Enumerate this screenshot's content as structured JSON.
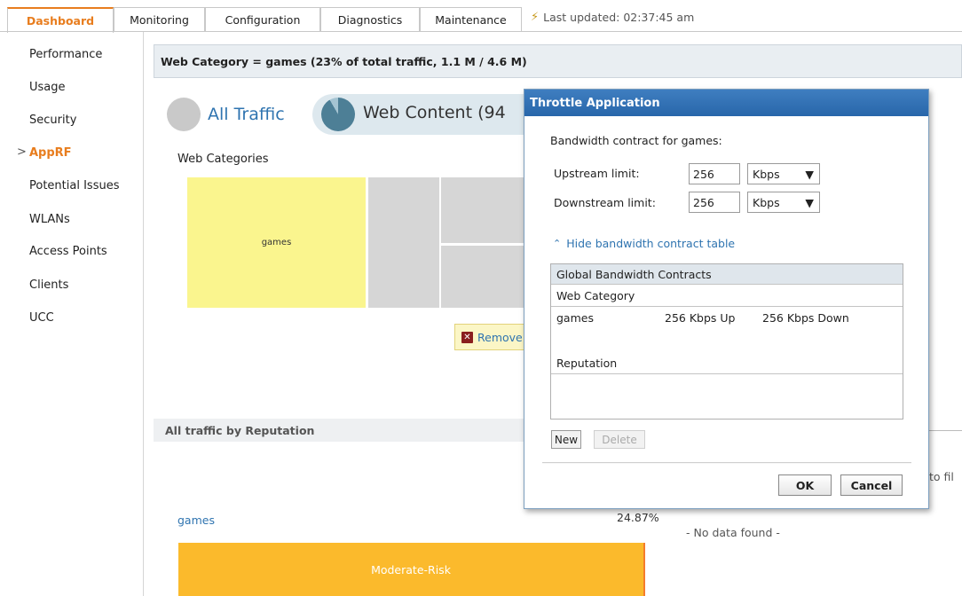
{
  "tabs": [
    {
      "label": "Dashboard",
      "active": true
    },
    {
      "label": "Monitoring"
    },
    {
      "label": "Configuration"
    },
    {
      "label": "Diagnostics"
    },
    {
      "label": "Maintenance"
    }
  ],
  "last_updated": "Last updated: 02:37:45 am",
  "sidebar": {
    "items": [
      {
        "label": "Performance"
      },
      {
        "label": "Usage"
      },
      {
        "label": "Security"
      },
      {
        "label": "AppRF",
        "active": true
      },
      {
        "label": "Potential Issues"
      },
      {
        "label": "WLANs"
      },
      {
        "label": "Access Points"
      },
      {
        "label": "Clients"
      },
      {
        "label": "UCC"
      }
    ],
    "active_marker": ">"
  },
  "main": {
    "category_header": "Web Category = games (23% of total traffic, 1.1 M / 4.6 M)",
    "pill_all_traffic": "All Traffic",
    "pill_web_content": "Web Content (94",
    "web_categories_label": "Web Categories",
    "treemap_games_label": "games",
    "remove_button": "Remove",
    "reputation_header": "All traffic by Reputation",
    "to_filter_fragment": "to fil",
    "reputation_row_label": "games",
    "reputation_row_percent": "24.87%",
    "no_data": "- No data found -",
    "bar_label": "Moderate-Risk"
  },
  "dialog": {
    "title": "Throttle Application",
    "description": "Bandwidth contract for games:",
    "upstream_label": "Upstream limit:",
    "upstream_value": "256",
    "upstream_unit": "Kbps",
    "downstream_label": "Downstream limit:",
    "downstream_value": "256",
    "downstream_unit": "Kbps",
    "hide_link": "Hide bandwidth contract table",
    "table": {
      "header": "Global Bandwidth Contracts",
      "section_web": "Web Category",
      "row": {
        "name": "games",
        "up": "256 Kbps Up",
        "down": "256 Kbps Down"
      },
      "section_reputation": "Reputation"
    },
    "new_button": "New",
    "delete_button": "Delete",
    "ok_button": "OK",
    "cancel_button": "Cancel"
  },
  "colors": {
    "accent_orange": "#e87d1e",
    "link_blue": "#2f74b0",
    "dialog_title_blue": "#2866aa",
    "games_yellow": "#faf58e",
    "moderate_risk": "#fbba2c"
  }
}
